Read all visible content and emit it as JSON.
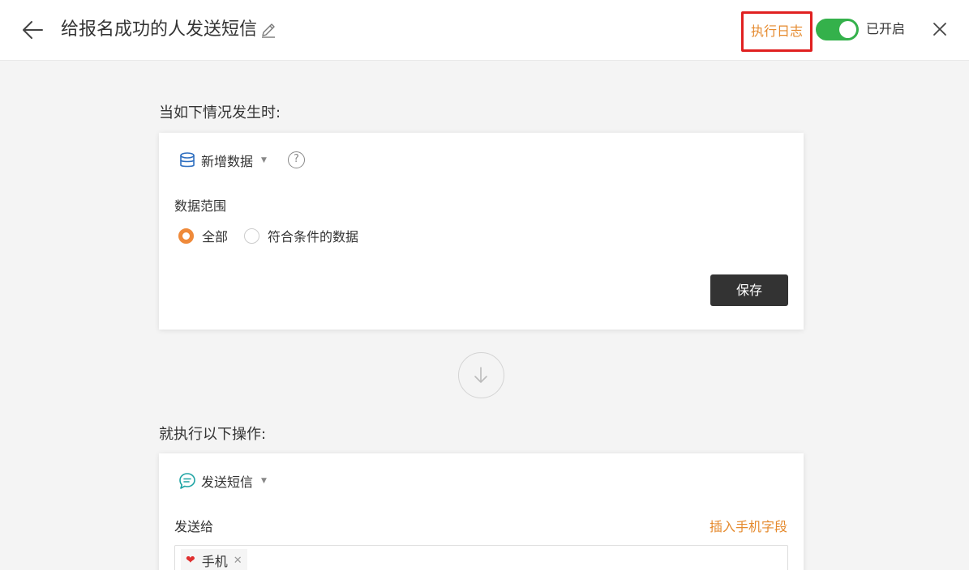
{
  "header": {
    "title": "给报名成功的人发送短信",
    "log_label": "执行日志",
    "toggle_label": "已开启",
    "toggle_on": true
  },
  "trigger": {
    "section_label": "当如下情况发生时:",
    "event_label": "新增数据",
    "help_glyph": "?",
    "scope_label": "数据范围",
    "options": [
      "全部",
      "符合条件的数据"
    ],
    "selected": "全部",
    "save_label": "保存"
  },
  "action": {
    "section_label": "就执行以下操作:",
    "action_label": "发送短信",
    "send_to_label": "发送给",
    "insert_label": "插入手机字段",
    "recipients": [
      "手机"
    ]
  },
  "colors": {
    "accent": "#e58a2e",
    "toggle": "#34b14b",
    "highlight_box": "#e02020",
    "database_icon": "#2f6fc0",
    "sms_icon": "#1ea4a4",
    "tag_heart": "#e03030"
  },
  "icons": {
    "back": "arrow-left-icon",
    "edit": "pencil-icon",
    "close": "close-icon",
    "trigger": "database-icon",
    "help": "question-circle-icon",
    "arrow": "arrow-down-icon",
    "action": "message-icon",
    "tag": "heart-icon"
  }
}
